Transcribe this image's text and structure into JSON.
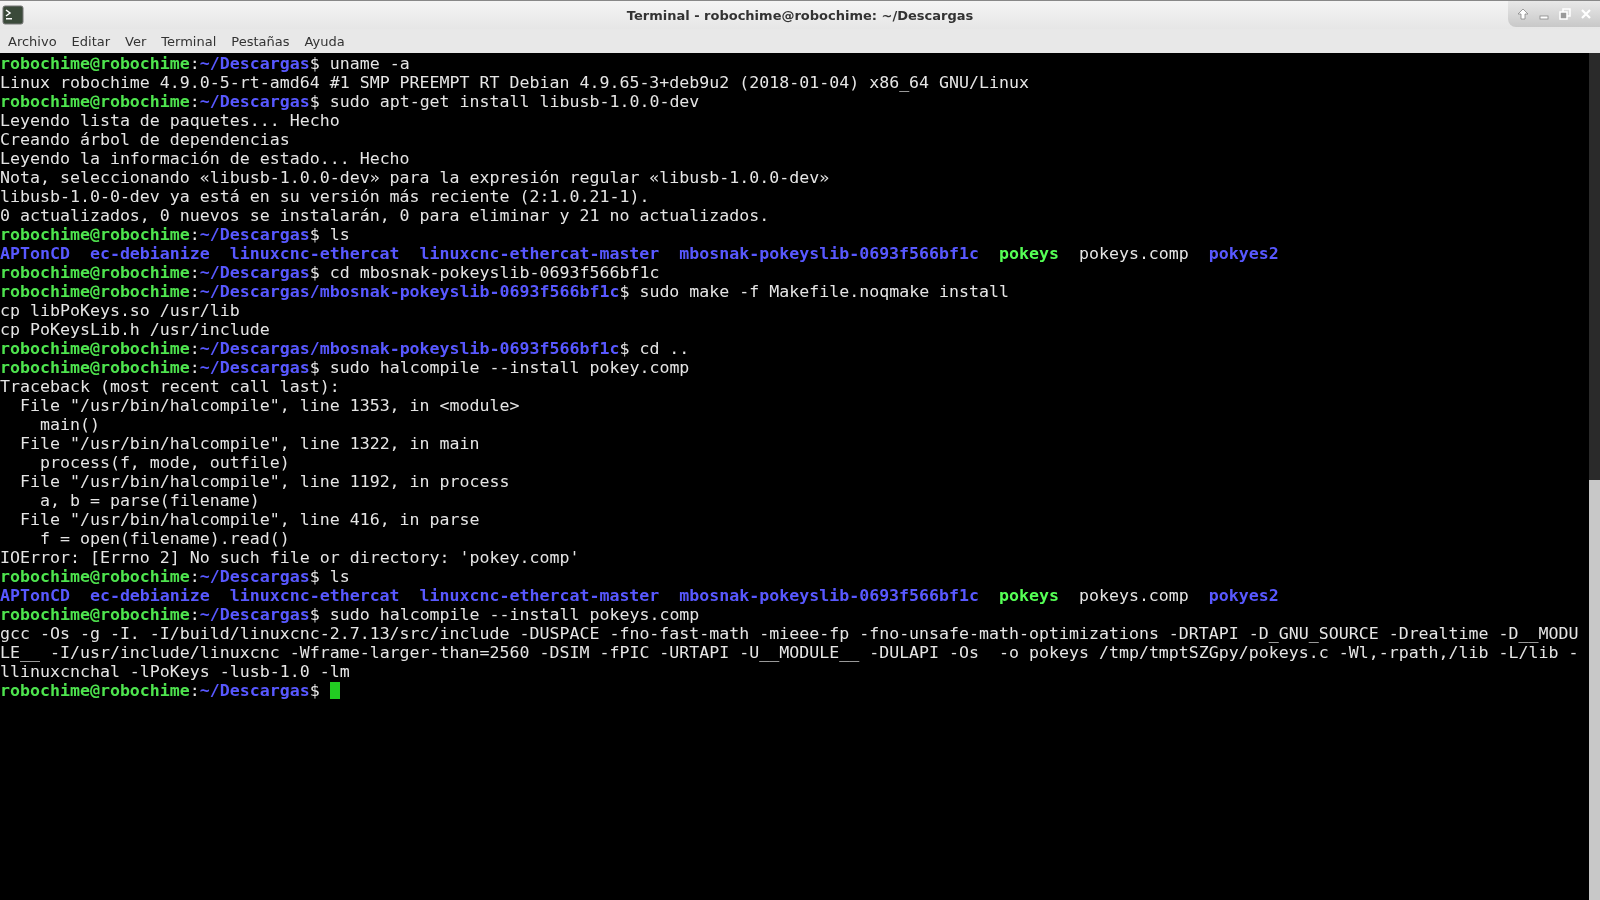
{
  "window": {
    "title": "Terminal - robochime@robochime: ~/Descargas"
  },
  "menu": [
    "Archivo",
    "Editar",
    "Ver",
    "Terminal",
    "Pestañas",
    "Ayuda"
  ],
  "lines": [
    {
      "kind": "prompt",
      "user": "robochime@robochime",
      "colon": ":",
      "path": "~/Descargas",
      "command": "$ uname -a",
      "cursor": false
    },
    {
      "kind": "output",
      "text": "Linux robochime 4.9.0-5-rt-amd64 #1 SMP PREEMPT RT Debian 4.9.65-3+deb9u2 (2018-01-04) x86_64 GNU/Linux"
    },
    {
      "kind": "prompt",
      "user": "robochime@robochime",
      "colon": ":",
      "path": "~/Descargas",
      "command": "$ sudo apt-get install libusb-1.0.0-dev",
      "cursor": false
    },
    {
      "kind": "output",
      "text": "Leyendo lista de paquetes... Hecho"
    },
    {
      "kind": "output",
      "text": "Creando árbol de dependencias"
    },
    {
      "kind": "output",
      "text": "Leyendo la información de estado... Hecho"
    },
    {
      "kind": "output",
      "text": "Nota, seleccionando «libusb-1.0.0-dev» para la expresión regular «libusb-1.0.0-dev»"
    },
    {
      "kind": "output",
      "text": "libusb-1.0-0-dev ya está en su versión más reciente (2:1.0.21-1)."
    },
    {
      "kind": "output",
      "text": "0 actualizados, 0 nuevos se instalarán, 0 para eliminar y 21 no actualizados."
    },
    {
      "kind": "prompt",
      "user": "robochime@robochime",
      "colon": ":",
      "path": "~/Descargas",
      "command": "$ ls",
      "cursor": false
    },
    {
      "kind": "listing",
      "entries": [
        {
          "name": "APTonCD",
          "color": "#5858ff",
          "bold": true
        },
        {
          "name": "ec-debianize",
          "color": "#5858ff",
          "bold": true
        },
        {
          "name": "linuxcnc-ethercat",
          "color": "#5858ff",
          "bold": true
        },
        {
          "name": "linuxcnc-ethercat-master",
          "color": "#5858ff",
          "bold": true
        },
        {
          "name": "mbosnak-pokeyslib-0693f566bf1c",
          "color": "#5858ff",
          "bold": true
        },
        {
          "name": "pokeys",
          "color": "#55ff55",
          "bold": true
        },
        {
          "name": "pokeys.comp",
          "color": "#e5e5e5",
          "bold": false
        },
        {
          "name": "pokyes2",
          "color": "#5858ff",
          "bold": true
        }
      ]
    },
    {
      "kind": "prompt",
      "user": "robochime@robochime",
      "colon": ":",
      "path": "~/Descargas",
      "command": "$ cd mbosnak-pokeyslib-0693f566bf1c",
      "cursor": false
    },
    {
      "kind": "prompt",
      "user": "robochime@robochime",
      "colon": ":",
      "path": "~/Descargas/mbosnak-pokeyslib-0693f566bf1c",
      "command": "$ sudo make -f Makefile.noqmake install",
      "cursor": false
    },
    {
      "kind": "output",
      "text": "cp libPoKeys.so /usr/lib"
    },
    {
      "kind": "output",
      "text": "cp PoKeysLib.h /usr/include"
    },
    {
      "kind": "prompt",
      "user": "robochime@robochime",
      "colon": ":",
      "path": "~/Descargas/mbosnak-pokeyslib-0693f566bf1c",
      "command": "$ cd ..",
      "cursor": false
    },
    {
      "kind": "prompt",
      "user": "robochime@robochime",
      "colon": ":",
      "path": "~/Descargas",
      "command": "$ sudo halcompile --install pokey.comp",
      "cursor": false
    },
    {
      "kind": "output",
      "text": "Traceback (most recent call last):"
    },
    {
      "kind": "output",
      "text": "  File \"/usr/bin/halcompile\", line 1353, in <module>"
    },
    {
      "kind": "output",
      "text": "    main()"
    },
    {
      "kind": "output",
      "text": "  File \"/usr/bin/halcompile\", line 1322, in main"
    },
    {
      "kind": "output",
      "text": "    process(f, mode, outfile)"
    },
    {
      "kind": "output",
      "text": "  File \"/usr/bin/halcompile\", line 1192, in process"
    },
    {
      "kind": "output",
      "text": "    a, b = parse(filename)"
    },
    {
      "kind": "output",
      "text": "  File \"/usr/bin/halcompile\", line 416, in parse"
    },
    {
      "kind": "output",
      "text": "    f = open(filename).read()"
    },
    {
      "kind": "output",
      "text": "IOError: [Errno 2] No such file or directory: 'pokey.comp'"
    },
    {
      "kind": "prompt",
      "user": "robochime@robochime",
      "colon": ":",
      "path": "~/Descargas",
      "command": "$ ls",
      "cursor": false
    },
    {
      "kind": "listing",
      "entries": [
        {
          "name": "APTonCD",
          "color": "#5858ff",
          "bold": true
        },
        {
          "name": "ec-debianize",
          "color": "#5858ff",
          "bold": true
        },
        {
          "name": "linuxcnc-ethercat",
          "color": "#5858ff",
          "bold": true
        },
        {
          "name": "linuxcnc-ethercat-master",
          "color": "#5858ff",
          "bold": true
        },
        {
          "name": "mbosnak-pokeyslib-0693f566bf1c",
          "color": "#5858ff",
          "bold": true
        },
        {
          "name": "pokeys",
          "color": "#55ff55",
          "bold": true
        },
        {
          "name": "pokeys.comp",
          "color": "#e5e5e5",
          "bold": false
        },
        {
          "name": "pokyes2",
          "color": "#5858ff",
          "bold": true
        }
      ]
    },
    {
      "kind": "prompt",
      "user": "robochime@robochime",
      "colon": ":",
      "path": "~/Descargas",
      "command": "$ sudo halcompile --install pokeys.comp",
      "cursor": false
    },
    {
      "kind": "output",
      "text": "gcc -Os -g -I. -I/build/linuxcnc-2.7.13/src/include -DUSPACE -fno-fast-math -mieee-fp -fno-unsafe-math-optimizations -DRTAPI -D_GNU_SOURCE -Drealtime -D__MODU"
    },
    {
      "kind": "output",
      "text": "LE__ -I/usr/include/linuxcnc -Wframe-larger-than=2560 -DSIM -fPIC -URTAPI -U__MODULE__ -DULAPI -Os  -o pokeys /tmp/tmptSZGpy/pokeys.c -Wl,-rpath,/lib -L/lib -"
    },
    {
      "kind": "output",
      "text": "llinuxcnchal -lPoKeys -lusb-1.0 -lm"
    },
    {
      "kind": "prompt",
      "user": "robochime@robochime",
      "colon": ":",
      "path": "~/Descargas",
      "command": "$ ",
      "cursor": true
    }
  ]
}
